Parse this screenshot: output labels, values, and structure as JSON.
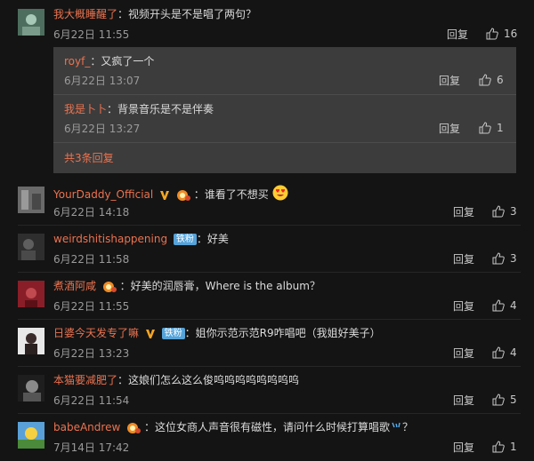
{
  "comments": [
    {
      "user": "我大概睡醒了",
      "text": "：视频开头是不是唱了两句？",
      "time": "6月22日 11:55",
      "reply": "回复",
      "likes": "16"
    },
    {
      "user": "YourDaddy_Official",
      "text": "：谁看了不想买",
      "time": "6月22日 14:18",
      "reply": "回复",
      "likes": "3"
    },
    {
      "user": "weirdshitishappening",
      "badge": "铁粉",
      "text": "：好美",
      "time": "6月22日 11:58",
      "reply": "回复",
      "likes": "3"
    },
    {
      "user": "煮酒阿咸",
      "text": "：好美的润唇膏，Where is the album？",
      "time": "6月22日 11:55",
      "reply": "回复",
      "likes": "4"
    },
    {
      "user": "日婆今天发专了嘛",
      "badge": "铁粉",
      "text": "：姐你示范示范R9咋唱吧（我姐好美子）",
      "time": "6月22日 13:23",
      "reply": "回复",
      "likes": "4"
    },
    {
      "user": "本猫要减肥了",
      "text": "：这娘们怎么这么俊呜呜呜呜呜呜呜呜",
      "time": "6月22日 11:54",
      "reply": "回复",
      "likes": "5"
    },
    {
      "user": "babeAndrew",
      "text": "：这位女商人声音很有磁性，请问什么时候打算唱歌",
      "text_end": "？",
      "time": "7月14日 17:42",
      "reply": "回复",
      "likes": "1"
    }
  ],
  "sub_replies": [
    {
      "user": "royf_",
      "text": "：又疯了一个",
      "time": "6月22日 13:07",
      "reply": "回复",
      "likes": "6"
    },
    {
      "user": "我是卜卜",
      "text": "：背景音乐是不是伴奏",
      "time": "6月22日 13:27",
      "reply": "回复",
      "likes": "1"
    }
  ],
  "more_replies": "共3条回复",
  "colors": {
    "username": "#eb7350",
    "background": "#141414",
    "subbox": "#3c3c3c",
    "fan_badge": "#55a3d9"
  }
}
